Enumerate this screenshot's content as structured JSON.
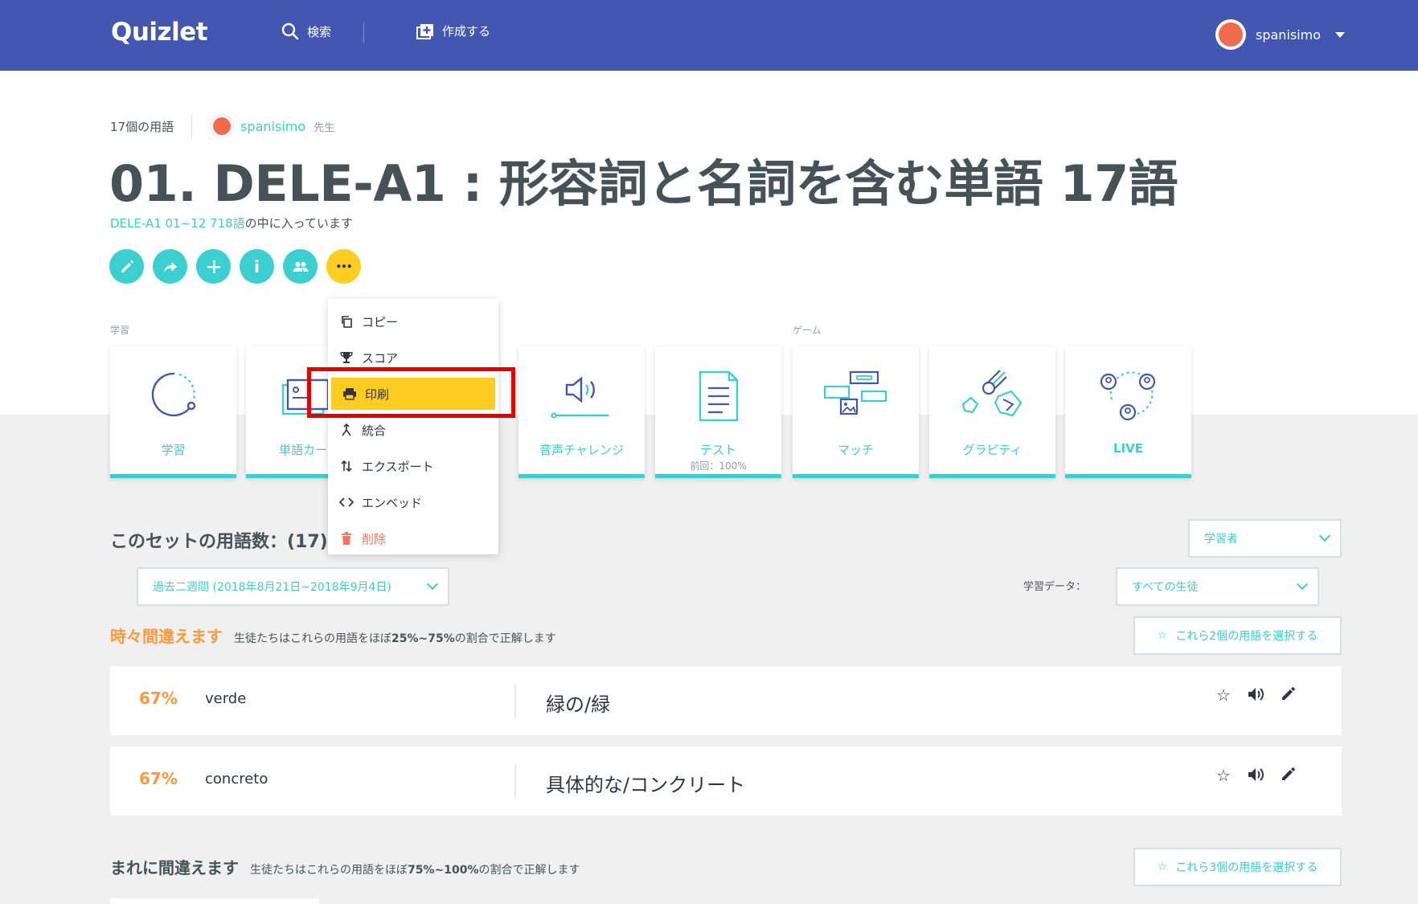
{
  "header": {
    "logo": "Quizlet",
    "search_label": "検索",
    "create_label": "作成する",
    "username": "spanisimo",
    "icons": [
      "search-icon",
      "add-set-icon",
      "avatar",
      "caret-down-icon"
    ]
  },
  "set": {
    "term_count_label": "17個の用語",
    "author": "spanisimo",
    "author_role": "先生",
    "title": "01. DELE-A1 : 形容詞と名詞を含む単語 17語",
    "folder_link": "DELE-A1 01~12 718語",
    "folder_suffix": "の中に入っています"
  },
  "actions": {
    "edit": "✎",
    "share": "➦",
    "add": "+",
    "info": "i",
    "class": "👥",
    "more": "•••"
  },
  "menu": {
    "items": [
      "コピー",
      "スコア",
      "印刷",
      "統合",
      "エクスポート",
      "エンベッド",
      "削除"
    ],
    "highlighted": "印刷"
  },
  "sections": {
    "study": "学習",
    "games": "ゲーム"
  },
  "modes": {
    "learn": "学習",
    "flashcards": "単語カード",
    "spell": "音声チャレンジ",
    "test": "テスト",
    "test_sub": "前回：100%",
    "match": "マッチ",
    "gravity": "グラビティ",
    "live": "LIVE"
  },
  "terms": {
    "heading": "このセットの用語数：(17)",
    "filter_period": "過去二週間 (2018年8月21日~2018年9月4日)",
    "view_select": "学習者",
    "study_data_label": "学習データ：",
    "students_select": "すべての生徒",
    "group1": {
      "name": "時々間違えます",
      "desc_prefix": "生徒たちはこれらの用語をほぼ",
      "desc_range": "25%~75%",
      "desc_suffix": "の割合で正解します",
      "select_btn": "これら2個の用語を選択する"
    },
    "group2": {
      "name": "まれに間違えます",
      "desc_prefix": "生徒たちはこれらの用語をほぼ",
      "desc_range": "75%~100%",
      "desc_suffix": "の割合で正解します",
      "select_btn": "これら3個の用語を選択する"
    },
    "rows": [
      {
        "pct": "67%",
        "word": "verde",
        "def": "緑の/緑"
      },
      {
        "pct": "67%",
        "word": "concreto",
        "def": "具体的な/コンクリート"
      }
    ]
  },
  "colors": {
    "header": "#4257b2",
    "teal": "#3ccfcf",
    "yellow": "#ffcd1f",
    "orange": "#ff983a",
    "danger": "#ff725b",
    "highlight_box": "#e60000"
  }
}
